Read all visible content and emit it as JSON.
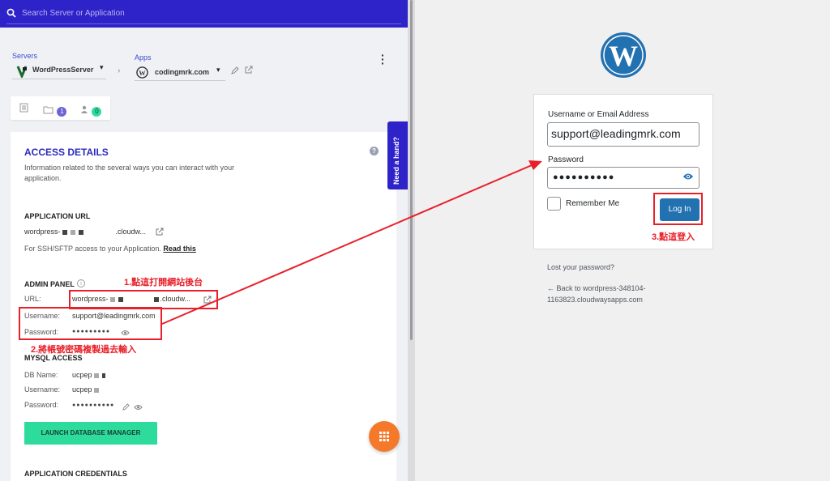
{
  "search": {
    "placeholder": "Search Server or Application"
  },
  "breadcrumb": {
    "servers_label": "Servers",
    "server_name": "WordPressServer",
    "apps_label": "Apps",
    "app_name": "codingmrk.com"
  },
  "tabs": {
    "files_count": "1",
    "users_count": "0"
  },
  "access": {
    "title": "ACCESS DETAILS",
    "description": "Information related to the several ways you can interact with your application.",
    "app_url_title": "APPLICATION URL",
    "app_url_prefix": "wordpress-",
    "app_url_suffix": ".cloudw...",
    "ssh_note": "For SSH/SFTP access to your Application.",
    "read_this": "Read this",
    "admin_title": "ADMIN PANEL",
    "url_label": "URL:",
    "admin_url_prefix": "wordpress-",
    "admin_url_suffix": ".cloudw...",
    "username_label": "Username:",
    "username_value": "support@leadingmrk.com",
    "password_label": "Password:",
    "password_mask": "●●●●●●●●●",
    "mysql_title": "MYSQL ACCESS",
    "db_name_label": "DB Name:",
    "db_name_value": "ucpep",
    "db_user_label": "Username:",
    "db_user_value": "ucpep",
    "db_pwd_label": "Password:",
    "db_pwd_mask": "●●●●●●●●●●",
    "launch_db": "LAUNCH DATABASE MANAGER",
    "app_creds_title": "APPLICATION CREDENTIALS"
  },
  "need_hand": "Need a hand?",
  "login": {
    "username_label": "Username or Email Address",
    "username_value": "support@leadingmrk.com",
    "password_label": "Password",
    "password_mask": "●●●●●●●●●●",
    "remember": "Remember Me",
    "login_button": "Log In",
    "lost_password": "Lost your password?",
    "back_link": "← Back to wordpress-348104-1163823.cloudwaysapps.com"
  },
  "annotations": {
    "step1": "1.點這打開網站後台",
    "step2": "2.將帳號密碼複製過去輸入",
    "step3": "3.點這登入",
    "color": "#e8202a"
  },
  "colors": {
    "brand": "#2e22c9",
    "accent_green": "#2ddc9c",
    "wp_blue": "#2271b1",
    "fab": "#f5792a"
  }
}
